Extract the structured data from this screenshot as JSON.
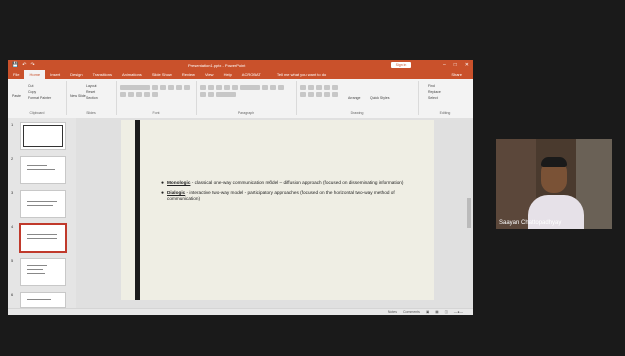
{
  "window": {
    "title": "Presentation1.pptx - PowerPoint",
    "qat_icons": [
      "save-icon",
      "undo-icon",
      "redo-icon"
    ],
    "sign_in_label": "Sign in",
    "controls": [
      "–",
      "□",
      "✕"
    ]
  },
  "ribbon": {
    "tabs": [
      "File",
      "Home",
      "Insert",
      "Design",
      "Transitions",
      "Animations",
      "Slide Show",
      "Review",
      "View",
      "Help",
      "ACROBAT"
    ],
    "active_tab_index": 1,
    "tell_me": "Tell me what you want to do",
    "share": "Share",
    "groups": [
      {
        "label": "Clipboard",
        "items": [
          "Cut",
          "Copy",
          "Format Painter"
        ],
        "button": "Paste"
      },
      {
        "label": "Slides",
        "items": [
          "Layout",
          "Reset",
          "Section"
        ],
        "button": "New Slide"
      },
      {
        "label": "Font",
        "items": []
      },
      {
        "label": "Paragraph",
        "items": []
      },
      {
        "label": "Drawing",
        "items": [
          "Arrange",
          "Quick Styles"
        ]
      },
      {
        "label": "Editing",
        "items": [
          "Find",
          "Replace",
          "Select"
        ]
      }
    ]
  },
  "thumbnails": {
    "numbers": [
      "1",
      "2",
      "3",
      "4",
      "5",
      "6"
    ],
    "selected_index": 3
  },
  "slide": {
    "bullets": [
      {
        "keyword": "Monologic",
        "text": " - classical one-way communication model – diffusion approach (focused on disseminating information)"
      },
      {
        "keyword": "Dialogic",
        "text": " - interactive two-way model - participatory approaches (focused on the horizontal two-way method of communication)"
      }
    ]
  },
  "statusbar": {
    "left": "",
    "notes": "Notes",
    "comments": "Comments"
  },
  "video": {
    "participant_name": "Saayan Chattopadhyay"
  },
  "colors": {
    "ppt_accent": "#c9512b",
    "selected_thumb": "#c0392b",
    "meeting_bg": "#1a1a1a"
  }
}
